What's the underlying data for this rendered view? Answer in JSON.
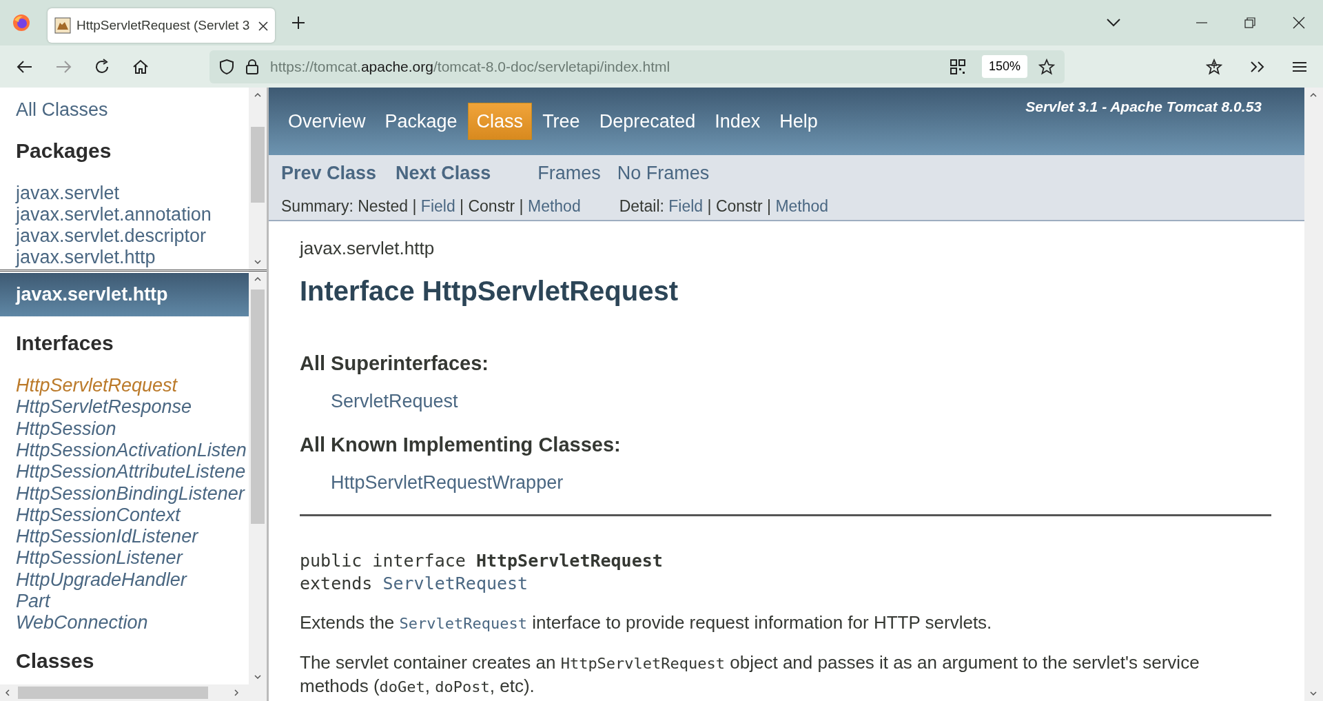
{
  "browser": {
    "tab_title": "HttpServletRequest (Servlet 3",
    "url": {
      "host": "https://tomcat.",
      "domain": "apache.org",
      "path": "/tomcat-8.0-doc/servletapi/index.html"
    },
    "zoom": "150%"
  },
  "packages_frame": {
    "all_classes": "All Classes",
    "heading": "Packages",
    "packages": [
      "javax.servlet",
      "javax.servlet.annotation",
      "javax.servlet.descriptor",
      "javax.servlet.http"
    ]
  },
  "package_frame": {
    "title": "javax.servlet.http",
    "sections": [
      {
        "heading": "Interfaces",
        "items": [
          {
            "label": "HttpServletRequest",
            "selected": true
          },
          {
            "label": "HttpServletResponse",
            "selected": false
          },
          {
            "label": "HttpSession",
            "selected": false
          },
          {
            "label": "HttpSessionActivationListen",
            "selected": false
          },
          {
            "label": "HttpSessionAttributeListene",
            "selected": false
          },
          {
            "label": "HttpSessionBindingListener",
            "selected": false
          },
          {
            "label": "HttpSessionContext",
            "selected": false
          },
          {
            "label": "HttpSessionIdListener",
            "selected": false
          },
          {
            "label": "HttpSessionListener",
            "selected": false
          },
          {
            "label": "HttpUpgradeHandler",
            "selected": false
          },
          {
            "label": "Part",
            "selected": false
          },
          {
            "label": "WebConnection",
            "selected": false
          }
        ]
      },
      {
        "heading": "Classes"
      }
    ]
  },
  "navbar": {
    "items": [
      {
        "label": "Overview",
        "selected": false
      },
      {
        "label": "Package",
        "selected": false
      },
      {
        "label": "Class",
        "selected": true
      },
      {
        "label": "Tree",
        "selected": false
      },
      {
        "label": "Deprecated",
        "selected": false
      },
      {
        "label": "Index",
        "selected": false
      },
      {
        "label": "Help",
        "selected": false
      }
    ],
    "about": "Servlet 3.1 - Apache Tomcat 8.0.53"
  },
  "subnav": {
    "class_links": [
      "Prev Class",
      "Next Class"
    ],
    "frame_links": [
      "Frames",
      "No Frames"
    ],
    "separator": "|",
    "summary": {
      "label": "Summary:",
      "items": [
        {
          "text": "Nested",
          "kind": "plain"
        },
        {
          "text": "Field",
          "kind": "link"
        },
        {
          "text": "Constr",
          "kind": "plain"
        },
        {
          "text": "Method",
          "kind": "link"
        }
      ]
    },
    "detail": {
      "label": "Detail:",
      "items": [
        {
          "text": "Field",
          "kind": "link"
        },
        {
          "text": "Constr",
          "kind": "plain"
        },
        {
          "text": "Method",
          "kind": "link"
        }
      ]
    }
  },
  "content": {
    "package": "javax.servlet.http",
    "title": "Interface HttpServletRequest",
    "lists": [
      {
        "heading": "All Superinterfaces:",
        "items": [
          "ServletRequest"
        ]
      },
      {
        "heading": "All Known Implementing Classes:",
        "items": [
          "HttpServletRequestWrapper"
        ]
      }
    ],
    "signature": {
      "prefix": "public interface",
      "name": "HttpServletRequest",
      "extends_word": "extends",
      "extends_link": "ServletRequest"
    },
    "paragraphs": [
      [
        {
          "kind": "text",
          "text": "Extends the "
        },
        {
          "kind": "code-link",
          "text": "ServletRequest"
        },
        {
          "kind": "text",
          "text": " interface to provide request information for HTTP servlets."
        }
      ],
      [
        {
          "kind": "text",
          "text": "The servlet container creates an "
        },
        {
          "kind": "code",
          "text": "HttpServletRequest"
        },
        {
          "kind": "text",
          "text": " object and passes it as an argument to the servlet's service methods ("
        },
        {
          "kind": "code",
          "text": "doGet"
        },
        {
          "kind": "text",
          "text": ", "
        },
        {
          "kind": "code",
          "text": "doPost"
        },
        {
          "kind": "text",
          "text": ", etc)."
        }
      ]
    ]
  }
}
